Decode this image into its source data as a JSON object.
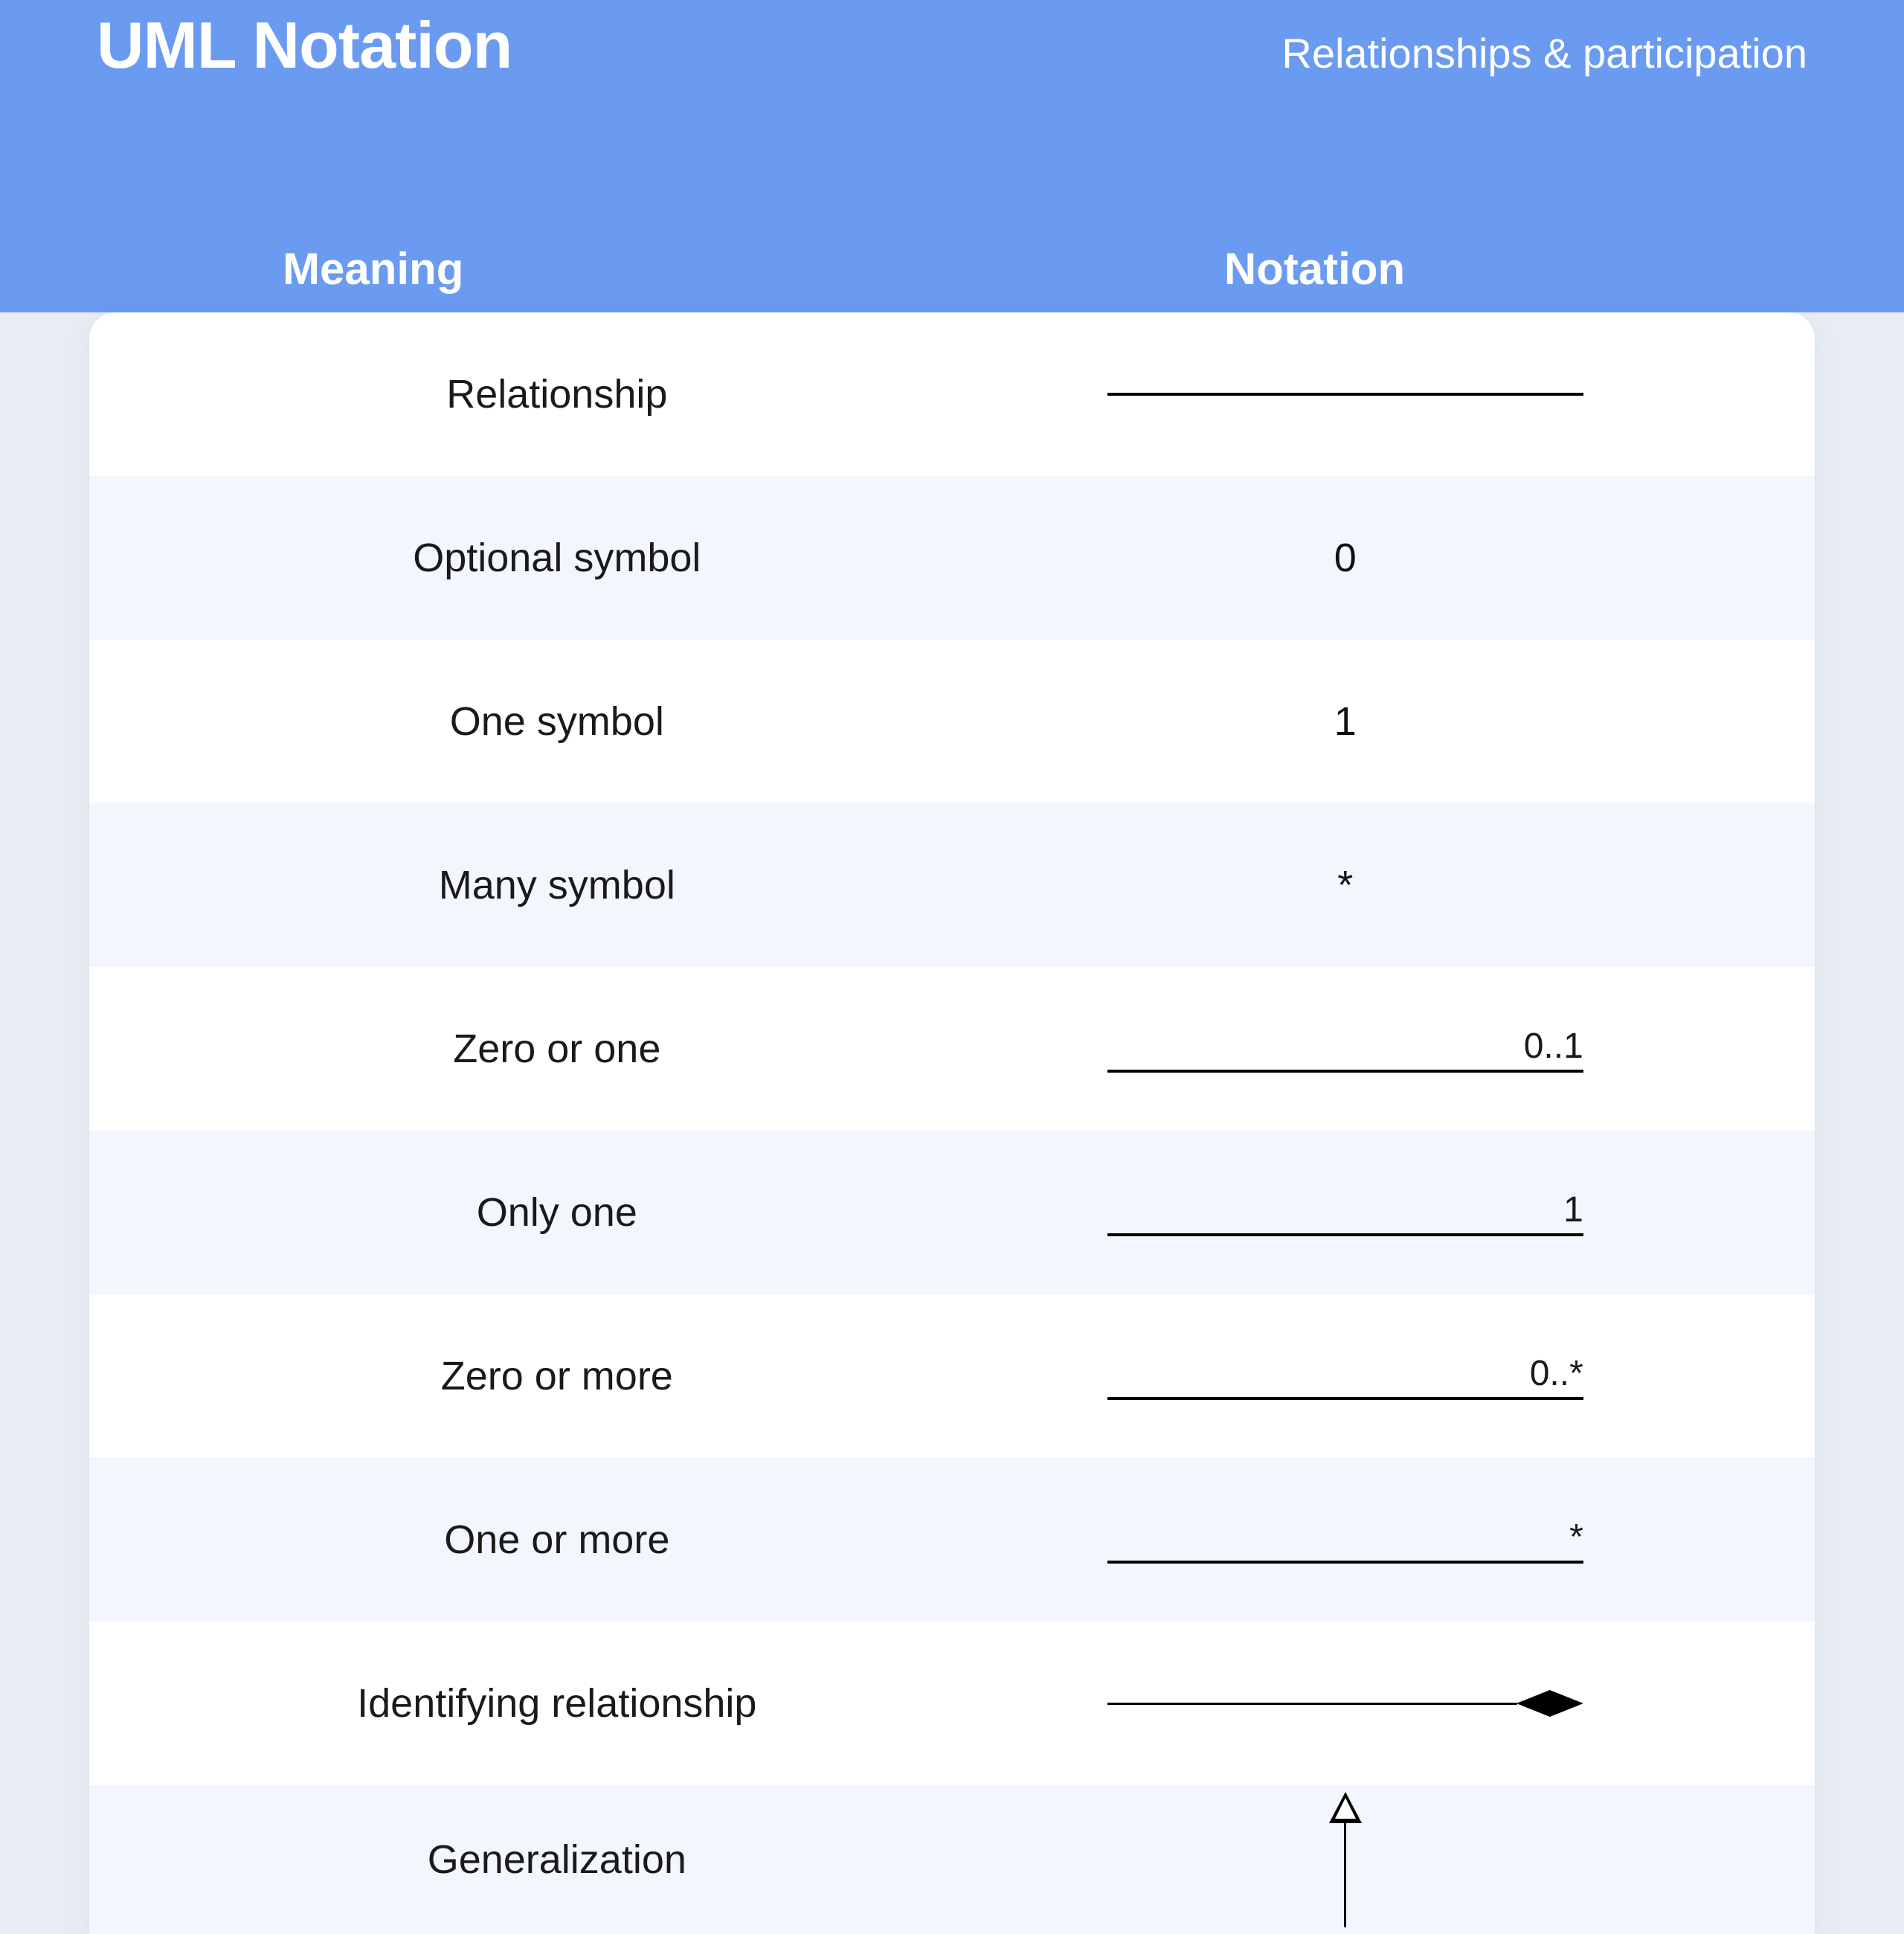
{
  "header": {
    "title": "UML Notation",
    "subtitle": "Relationships & participation",
    "col_meaning": "Meaning",
    "col_notation": "Notation"
  },
  "rows": [
    {
      "meaning": "Relationship",
      "kind": "line",
      "label": ""
    },
    {
      "meaning": "Optional symbol",
      "kind": "text",
      "label": "0"
    },
    {
      "meaning": "One symbol",
      "kind": "text",
      "label": "1"
    },
    {
      "meaning": "Many symbol",
      "kind": "text",
      "label": "*"
    },
    {
      "meaning": "Zero or one",
      "kind": "line-label",
      "label": "0..1"
    },
    {
      "meaning": "Only one",
      "kind": "line-label",
      "label": "1"
    },
    {
      "meaning": "Zero or more",
      "kind": "line-label",
      "label": "0..*"
    },
    {
      "meaning": "One or more",
      "kind": "line-label",
      "label": "*"
    },
    {
      "meaning": "Identifying relationship",
      "kind": "diamond",
      "label": ""
    },
    {
      "meaning": "Generalization",
      "kind": "gen-arrow",
      "label": ""
    }
  ]
}
